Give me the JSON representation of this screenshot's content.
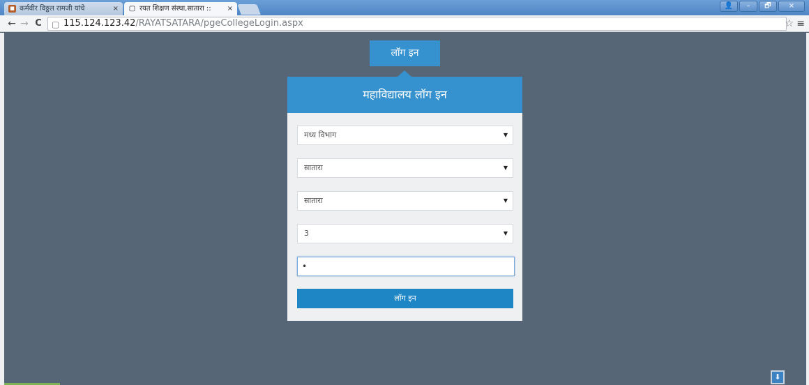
{
  "browser": {
    "tabs": [
      {
        "title": "कर्मवीर विठ्ठल रामजी यांचे",
        "icon": "photo-favicon",
        "active": false
      },
      {
        "title": "रयत शिक्षण संस्था,सातारा ::",
        "icon": "page-icon",
        "active": true
      }
    ],
    "close_glyph": "×",
    "window_buttons": {
      "user": "👤",
      "minimize": "–",
      "restore": "🗗",
      "close": "×"
    },
    "nav": {
      "back": "←",
      "forward": "→",
      "reload": "C"
    },
    "url": {
      "host": "115.124.123.42",
      "path": "/RAYATSATARA/pgeCollegeLogin.aspx"
    },
    "bookmark_star": "☆",
    "menu_glyph": "≡"
  },
  "login_tab_label": "लॉग इन",
  "card": {
    "title": "महाविद्यालय लॉग इन",
    "selects": [
      {
        "value": "मध्य विभाग"
      },
      {
        "value": "सातारा"
      },
      {
        "value": "सातारा"
      },
      {
        "value": "3"
      }
    ],
    "password_value": "•",
    "submit_label": "लॉग इन"
  },
  "colors": {
    "accent": "#3592cf",
    "button": "#1f86c6",
    "background": "#566677"
  }
}
